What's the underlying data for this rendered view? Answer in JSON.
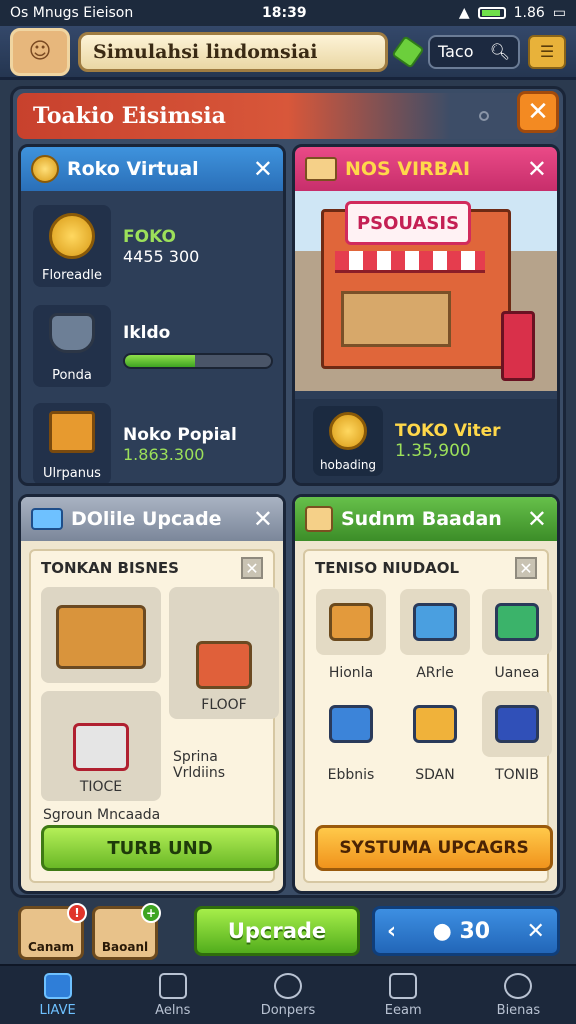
{
  "status": {
    "carrier": "Os Mnugs Eieison",
    "time": "18:39",
    "battery": "1.86"
  },
  "topbar": {
    "title": "Simulahsi lindomsiai",
    "search_text": "Taco"
  },
  "main": {
    "title": "Toakio Eisimsia"
  },
  "panel_virtual": {
    "title": "Roko Virtual",
    "rows": [
      {
        "icon_label": "Floreadle",
        "name": "FOKO",
        "value": "4455 300"
      },
      {
        "icon_label": "Ponda",
        "name": "Ikldo",
        "progress": 0.48
      },
      {
        "icon_label": "Ulrpanus",
        "name": "Noko Popial",
        "value": "1.863.300"
      }
    ]
  },
  "panel_shop": {
    "title": "NOS VIRBAI",
    "sign": "PSOUASIS",
    "coin_label": "hobading",
    "name": "TOKO Viter",
    "value": "1.35,900"
  },
  "panel_upgrade": {
    "title": "DOlile Upcade",
    "inner_title": "TONKAN BISNES",
    "cell_1_label": "FLOOF",
    "cell_2_label": "Sprina Vrldiins",
    "cell_3_label": "TIOCE",
    "caption": "Sgroun Mncaada",
    "button": "TURB UND"
  },
  "panel_system": {
    "title": "Sudnm Baadan",
    "inner_title": "TENISO NIUDAOL",
    "items": [
      "Hionla",
      "ARrle",
      "Uanea",
      "Ebbnis",
      "SDAN",
      "TONIB"
    ],
    "button": "SYSTUMA UPCAGRS"
  },
  "actions": {
    "left_1": "Canam",
    "left_2": "Baoanl",
    "upgrade": "Upcrade",
    "count": "30"
  },
  "tabs": [
    "LIAVE",
    "Aelns",
    "Donpers",
    "Eeam",
    "Bienas"
  ],
  "colors": {
    "accent_green": "#6ab826",
    "accent_blue": "#2266b8",
    "accent_orange": "#f0931c"
  }
}
